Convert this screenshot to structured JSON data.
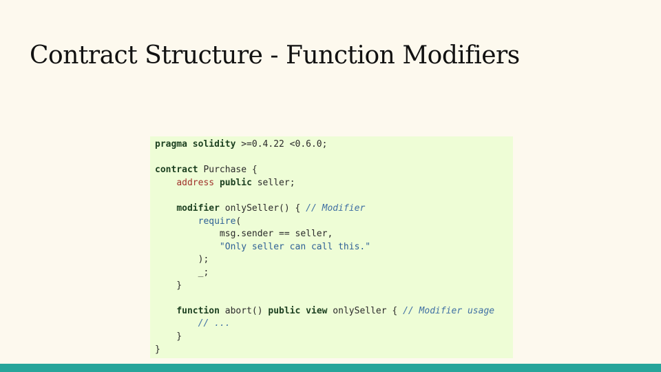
{
  "title": "Contract Structure - Function Modifiers",
  "code": {
    "lines": [
      [
        {
          "t": "kw",
          "s": "pragma solidity"
        },
        {
          "t": "plain",
          "s": " >=0.4.22 <0.6.0;"
        }
      ],
      [],
      [
        {
          "t": "kw",
          "s": "contract"
        },
        {
          "t": "plain",
          "s": " Purchase {"
        }
      ],
      [
        {
          "t": "plain",
          "s": "    "
        },
        {
          "t": "type",
          "s": "address"
        },
        {
          "t": "plain",
          "s": " "
        },
        {
          "t": "kw",
          "s": "public"
        },
        {
          "t": "plain",
          "s": " seller;"
        }
      ],
      [],
      [
        {
          "t": "plain",
          "s": "    "
        },
        {
          "t": "kw",
          "s": "modifier"
        },
        {
          "t": "plain",
          "s": " onlySeller() { "
        },
        {
          "t": "comment",
          "s": "// Modifier"
        }
      ],
      [
        {
          "t": "plain",
          "s": "        "
        },
        {
          "t": "str",
          "s": "require"
        },
        {
          "t": "plain",
          "s": "("
        }
      ],
      [
        {
          "t": "plain",
          "s": "            msg.sender == seller,"
        }
      ],
      [
        {
          "t": "plain",
          "s": "            "
        },
        {
          "t": "str",
          "s": "\"Only seller can call this.\""
        }
      ],
      [
        {
          "t": "plain",
          "s": "        );"
        }
      ],
      [
        {
          "t": "plain",
          "s": "        _;"
        }
      ],
      [
        {
          "t": "plain",
          "s": "    }"
        }
      ],
      [],
      [
        {
          "t": "plain",
          "s": "    "
        },
        {
          "t": "kw",
          "s": "function"
        },
        {
          "t": "plain",
          "s": " abort() "
        },
        {
          "t": "kw",
          "s": "public view"
        },
        {
          "t": "plain",
          "s": " onlySeller { "
        },
        {
          "t": "comment",
          "s": "// Modifier usage"
        }
      ],
      [
        {
          "t": "plain",
          "s": "        "
        },
        {
          "t": "comment",
          "s": "// ..."
        }
      ],
      [
        {
          "t": "plain",
          "s": "    }"
        }
      ],
      [
        {
          "t": "plain",
          "s": "}"
        }
      ]
    ]
  },
  "colors": {
    "background": "#fdf9ee",
    "code_background": "#eefdd6",
    "keyword": "#1b3f1f",
    "type": "#a0312a",
    "string": "#2d5f95",
    "comment": "#3f6fa3",
    "footer_bar": "#27a59a"
  }
}
